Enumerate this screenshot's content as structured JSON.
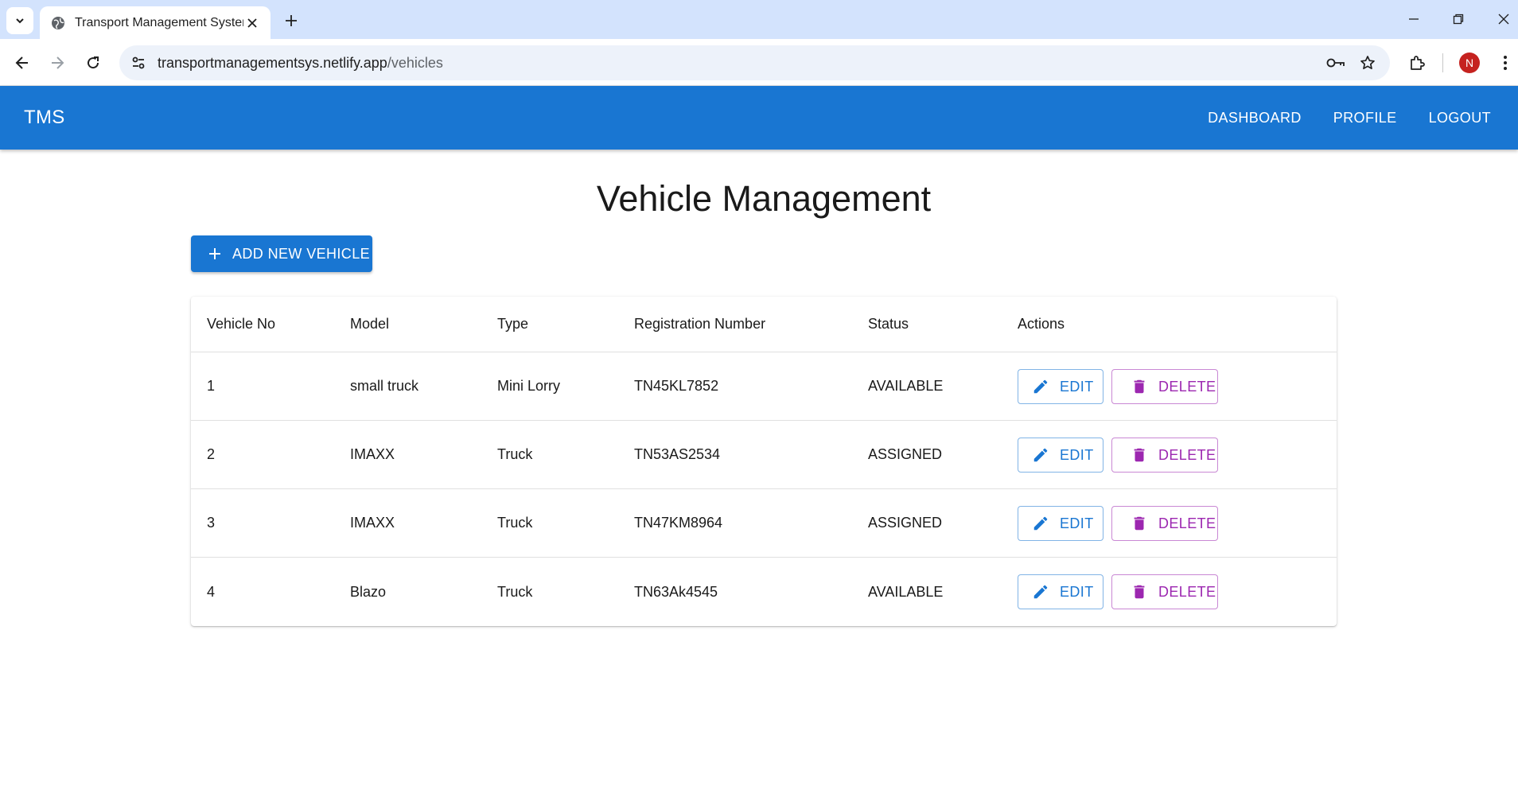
{
  "browser": {
    "tab_title": "Transport Management System",
    "url_host": "transportmanagementsys.netlify.app",
    "url_path": "/vehicles",
    "profile_initial": "N"
  },
  "appbar": {
    "brand": "TMS",
    "nav": [
      "DASHBOARD",
      "PROFILE",
      "LOGOUT"
    ]
  },
  "main": {
    "title": "Vehicle Management",
    "add_button_label": "ADD NEW VEHICLE",
    "table": {
      "columns": [
        "Vehicle No",
        "Model",
        "Type",
        "Registration Number",
        "Status",
        "Actions"
      ],
      "rows": [
        {
          "no": "1",
          "model": "small truck",
          "type": "Mini Lorry",
          "reg": "TN45KL7852",
          "status": "AVAILABLE"
        },
        {
          "no": "2",
          "model": "IMAXX",
          "type": "Truck",
          "reg": "TN53AS2534",
          "status": "ASSIGNED"
        },
        {
          "no": "3",
          "model": "IMAXX",
          "type": "Truck",
          "reg": "TN47KM8964",
          "status": "ASSIGNED"
        },
        {
          "no": "4",
          "model": "Blazo",
          "type": "Truck",
          "reg": "TN63Ak4545",
          "status": "AVAILABLE"
        }
      ],
      "edit_label": "EDIT",
      "delete_label": "DELETE"
    }
  },
  "colors": {
    "primary": "#1976d2",
    "secondary": "#9c27b0",
    "tabstrip": "#d3e3fd"
  }
}
